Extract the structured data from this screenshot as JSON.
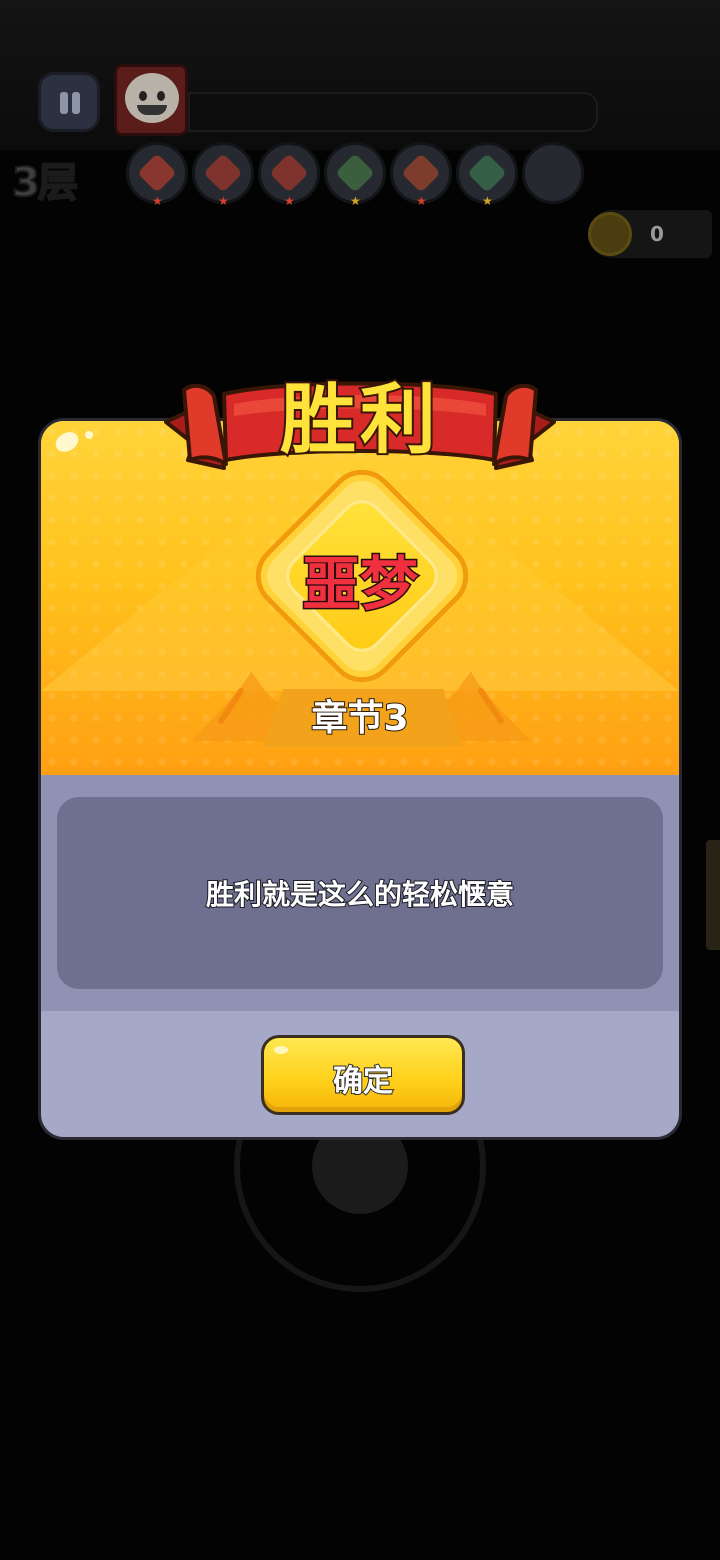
{
  "hud": {
    "floor_label": "3层",
    "coin_value": "0",
    "skills": [
      {
        "icon": "sword-skill-icon",
        "color": "#d8402e",
        "star_color": "#d8402e"
      },
      {
        "icon": "dagger-skill-icon",
        "color": "#c53a2a",
        "star_color": "#d8402e"
      },
      {
        "icon": "bullet-skill-icon",
        "color": "#c53a2a",
        "star_color": "#d8402e"
      },
      {
        "icon": "shield-skill-icon",
        "color": "#4c8a4a",
        "star_color": "#d4a51f"
      },
      {
        "icon": "boot-skill-icon",
        "color": "#c54a2a",
        "star_color": "#d8402e"
      },
      {
        "icon": "gear-skill-icon",
        "color": "#3f8a5a",
        "star_color": "#d4a51f"
      },
      {
        "icon": "empty-slot-icon",
        "color": "#262a30",
        "star_color": ""
      }
    ]
  },
  "modal": {
    "title": "胜利",
    "difficulty": "噩梦",
    "chapter": "章节3",
    "message": "胜利就是这么的轻松惬意",
    "confirm_label": "确定"
  },
  "colors": {
    "accent_yellow": "#ffd21c",
    "ribbon_red": "#d92a2a",
    "difficulty_red": "#f0303f",
    "panel_gray": "#6f708f"
  }
}
